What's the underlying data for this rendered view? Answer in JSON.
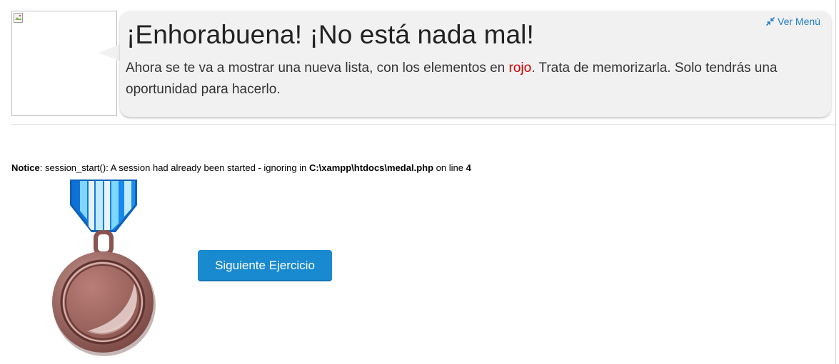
{
  "header": {
    "title": "¡Enhorabuena! ¡No está nada mal!",
    "message_part1": "Ahora se te va a mostrar una nueva lista, con los elementos en ",
    "message_highlight": "rojo",
    "message_part2": ". Trata de memorizarla. Solo tendrás una oportunidad para hacerlo.",
    "menu_link_label": "Ver Menú",
    "menu_icon": "compress-arrows-icon",
    "highlight_color": "#cc0000"
  },
  "notice": {
    "label": "Notice",
    "text_before": ": session_start(): A session had already been started - ignoring in ",
    "file_path": "C:\\xampp\\htdocs\\medal.php",
    "text_middle": " on line ",
    "line_number": "4"
  },
  "medal": {
    "icon": "bronze-medal-icon",
    "ribbon_colors": [
      "#1e90ff",
      "#7fd3ff",
      "#ffffff"
    ],
    "medal_color": "#a86d66"
  },
  "actions": {
    "next_label": "Siguiente Ejercicio",
    "button_color": "#1a8ad0"
  }
}
